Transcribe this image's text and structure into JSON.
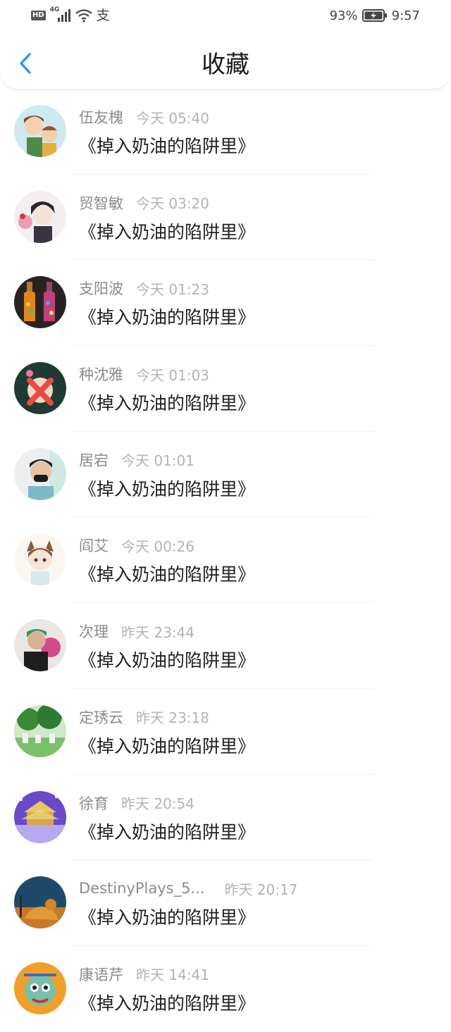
{
  "status_bar": {
    "network_label": "HD",
    "signal_label": "4G",
    "battery_percent": "93%",
    "time": "9:57",
    "icons": [
      "hd-icon",
      "signal-icon",
      "wifi-icon",
      "alipay-icon",
      "battery-icon"
    ]
  },
  "header": {
    "title": "收藏",
    "back_icon": "chevron-left-icon",
    "accent_color": "#2196F3"
  },
  "favorites": [
    {
      "user": "伍友槐",
      "time": "今天 05:40",
      "title": "《掉入奶油的陷阱里》"
    },
    {
      "user": "贸智敏",
      "time": "今天 03:20",
      "title": "《掉入奶油的陷阱里》"
    },
    {
      "user": "支阳波",
      "time": "今天 01:23",
      "title": "《掉入奶油的陷阱里》"
    },
    {
      "user": "种沈雅",
      "time": "今天 01:03",
      "title": "《掉入奶油的陷阱里》"
    },
    {
      "user": "居宕",
      "time": "今天 01:01",
      "title": "《掉入奶油的陷阱里》"
    },
    {
      "user": "阎艾",
      "time": "今天 00:26",
      "title": "《掉入奶油的陷阱里》"
    },
    {
      "user": "次理",
      "time": "昨天 23:44",
      "title": "《掉入奶油的陷阱里》"
    },
    {
      "user": "定琇云",
      "time": "昨天 23:18",
      "title": "《掉入奶油的陷阱里》"
    },
    {
      "user": "徐育",
      "time": "昨天 20:54",
      "title": "《掉入奶油的陷阱里》"
    },
    {
      "user": "DestinyPlays_5...",
      "time": "昨天 20:17",
      "title": "《掉入奶油的陷阱里》"
    },
    {
      "user": "康语芹",
      "time": "昨天 14:41",
      "title": "《掉入奶油的陷阱里》"
    }
  ]
}
